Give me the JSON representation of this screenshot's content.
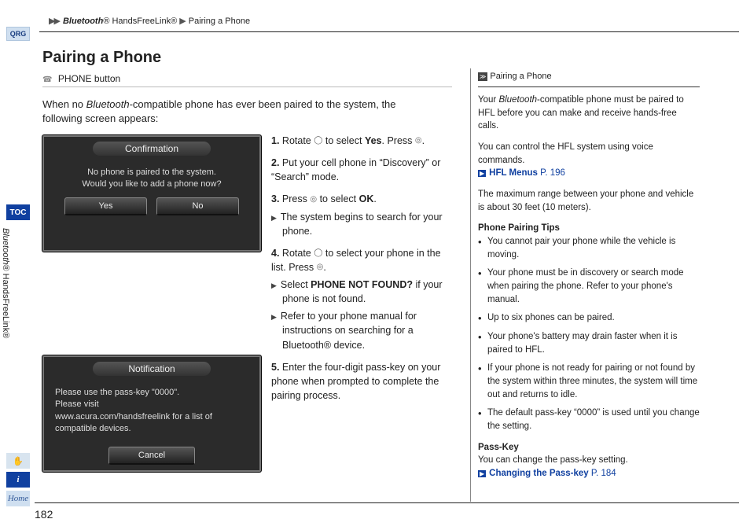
{
  "breadcrumb": {
    "seg1": "Bluetooth",
    "seg1_suffix": "® HandsFreeLink®",
    "seg2": "Pairing a Phone"
  },
  "qrg": "QRG",
  "title": "Pairing a Phone",
  "phone_button": "PHONE button",
  "intro_a": "When no ",
  "intro_i": "Bluetooth",
  "intro_b": "-compatible phone has ever been paired to the system, the following screen appears:",
  "shot1": {
    "title": "Confirmation",
    "line1": "No phone is paired to the system.",
    "line2": "Would you like to add a phone now?",
    "yes": "Yes",
    "no": "No"
  },
  "shot2": {
    "title": "Notification",
    "line1": "Please use the pass-key \"0000\".",
    "line2": "Please visit",
    "line3": "www.acura.com/handsfreelink for a list of compatible devices.",
    "cancel": "Cancel"
  },
  "steps": {
    "s1_a": "Rotate ",
    "s1_b": " to select ",
    "s1_yes": "Yes",
    "s1_c": ". Press ",
    "s1_d": ".",
    "s2": "Put your cell phone in “Discovery” or “Search” mode.",
    "s3_a": "Press ",
    "s3_b": " to select ",
    "s3_ok": "OK",
    "s3_c": ".",
    "s3_sub": "The system begins to search for your phone.",
    "s4_a": "Rotate ",
    "s4_b": " to select your phone in the list. Press ",
    "s4_c": ".",
    "s4_sub1_a": "Select ",
    "s4_sub1_b": "PHONE NOT FOUND?",
    "s4_sub1_c": " if your phone is not found.",
    "s4_sub2": "Refer to your phone manual for instructions on searching for a Bluetooth® device.",
    "s5": "Enter the four-digit pass-key on your phone when prompted to complete the pairing process."
  },
  "sidebar": {
    "head": "Pairing a Phone",
    "p1_a": "Your ",
    "p1_i": "Bluetooth",
    "p1_b": "-compatible phone must be paired to HFL before you can make and receive hands-free calls.",
    "p2": "You can control the HFL system using voice commands.",
    "link1_label": "HFL Menus",
    "link1_page": "P. 196",
    "p3": "The maximum range between your phone and vehicle is about 30 feet (10 meters).",
    "tips_head": "Phone Pairing Tips",
    "tips": [
      "You cannot pair your phone while the vehicle is moving.",
      "Your phone must be in discovery or search mode when pairing the phone. Refer to your phone's manual.",
      "Up to six phones can be paired.",
      "Your phone's battery may drain faster when it is paired to HFL.",
      "If your phone is not ready for pairing or not found by the system within three minutes, the system will time out and returns to idle.",
      "The default pass-key “0000” is used until you change the setting."
    ],
    "pk_head": "Pass-Key",
    "pk_text": "You can change the pass-key setting.",
    "link2_label": "Changing the Pass-key",
    "link2_page": "P. 184"
  },
  "toc": "TOC",
  "vtext_i": "Bluetooth",
  "vtext_b": "® HandsFreeLink®",
  "voice_icon": "✋",
  "info_icon": "i",
  "home_icon": "Home",
  "page_num": "182"
}
